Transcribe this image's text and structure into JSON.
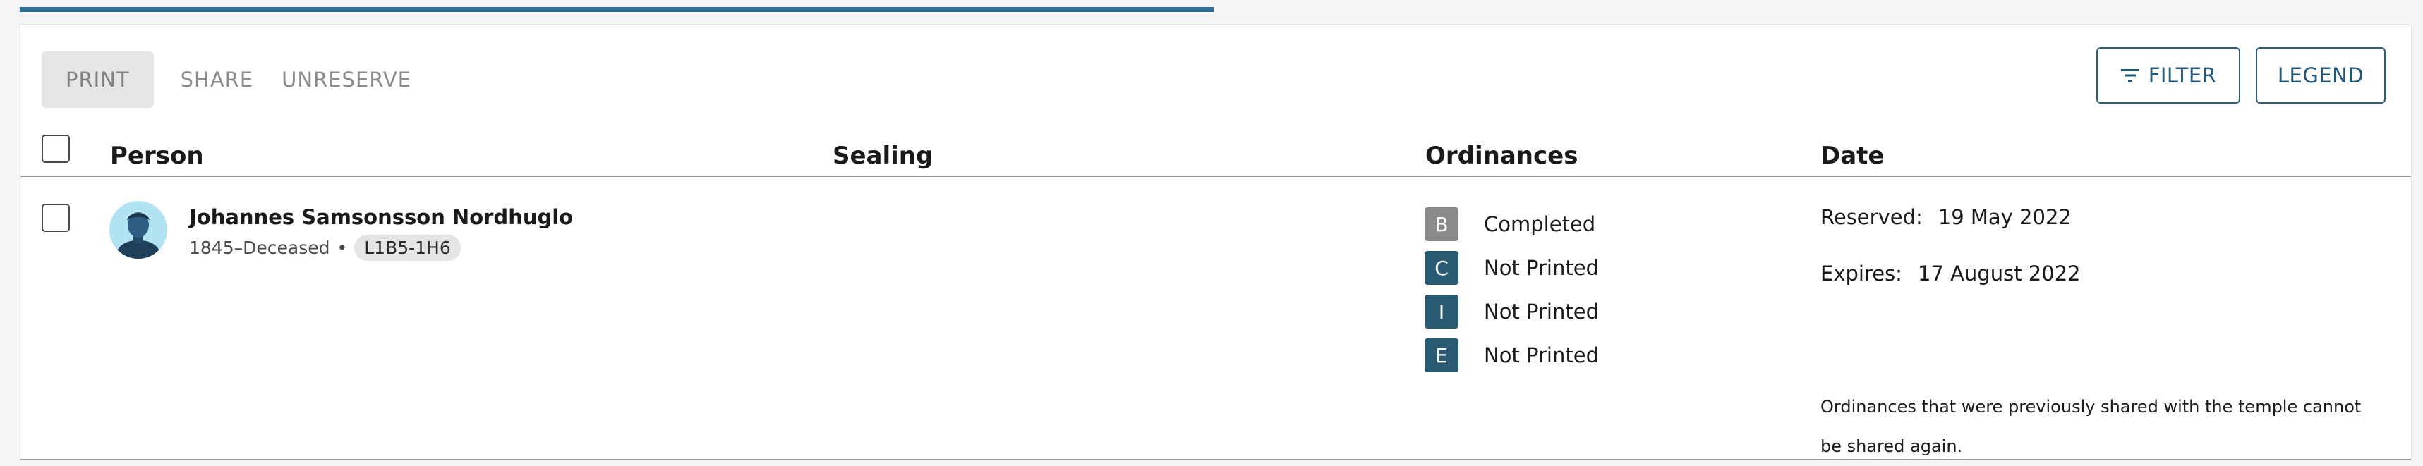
{
  "toolbar": {
    "print_label": "PRINT",
    "share_label": "SHARE",
    "unreserve_label": "UNRESERVE",
    "filter_label": "FILTER",
    "legend_label": "LEGEND"
  },
  "table": {
    "columns": {
      "person": "Person",
      "sealing": "Sealing",
      "ordinances": "Ordinances",
      "date": "Date"
    },
    "rows": [
      {
        "name": "Johannes Samsonsson Nordhuglo",
        "lifespan": "1845–Deceased",
        "separator": "•",
        "person_id": "L1B5-1H6",
        "ordinances": [
          {
            "code": "B",
            "status": "Completed",
            "color": "#8a8a8a"
          },
          {
            "code": "C",
            "status": "Not Printed",
            "color": "#2b5a73"
          },
          {
            "code": "I",
            "status": "Not Printed",
            "color": "#2b5a73"
          },
          {
            "code": "E",
            "status": "Not Printed",
            "color": "#2b5a73"
          }
        ],
        "reserved_label": "Reserved:",
        "reserved_date": "19 May 2022",
        "expires_label": "Expires:",
        "expires_date": "17 August 2022",
        "note": "Ordinances that were previously shared with the temple cannot be shared again."
      }
    ]
  },
  "colors": {
    "accent": "#2d6f9b",
    "button_border": "#2d5f7d",
    "avatar_bg": "#b2e3f3"
  },
  "icons": {
    "filter": "filter-lines-icon",
    "avatar": "person-silhouette-icon"
  }
}
